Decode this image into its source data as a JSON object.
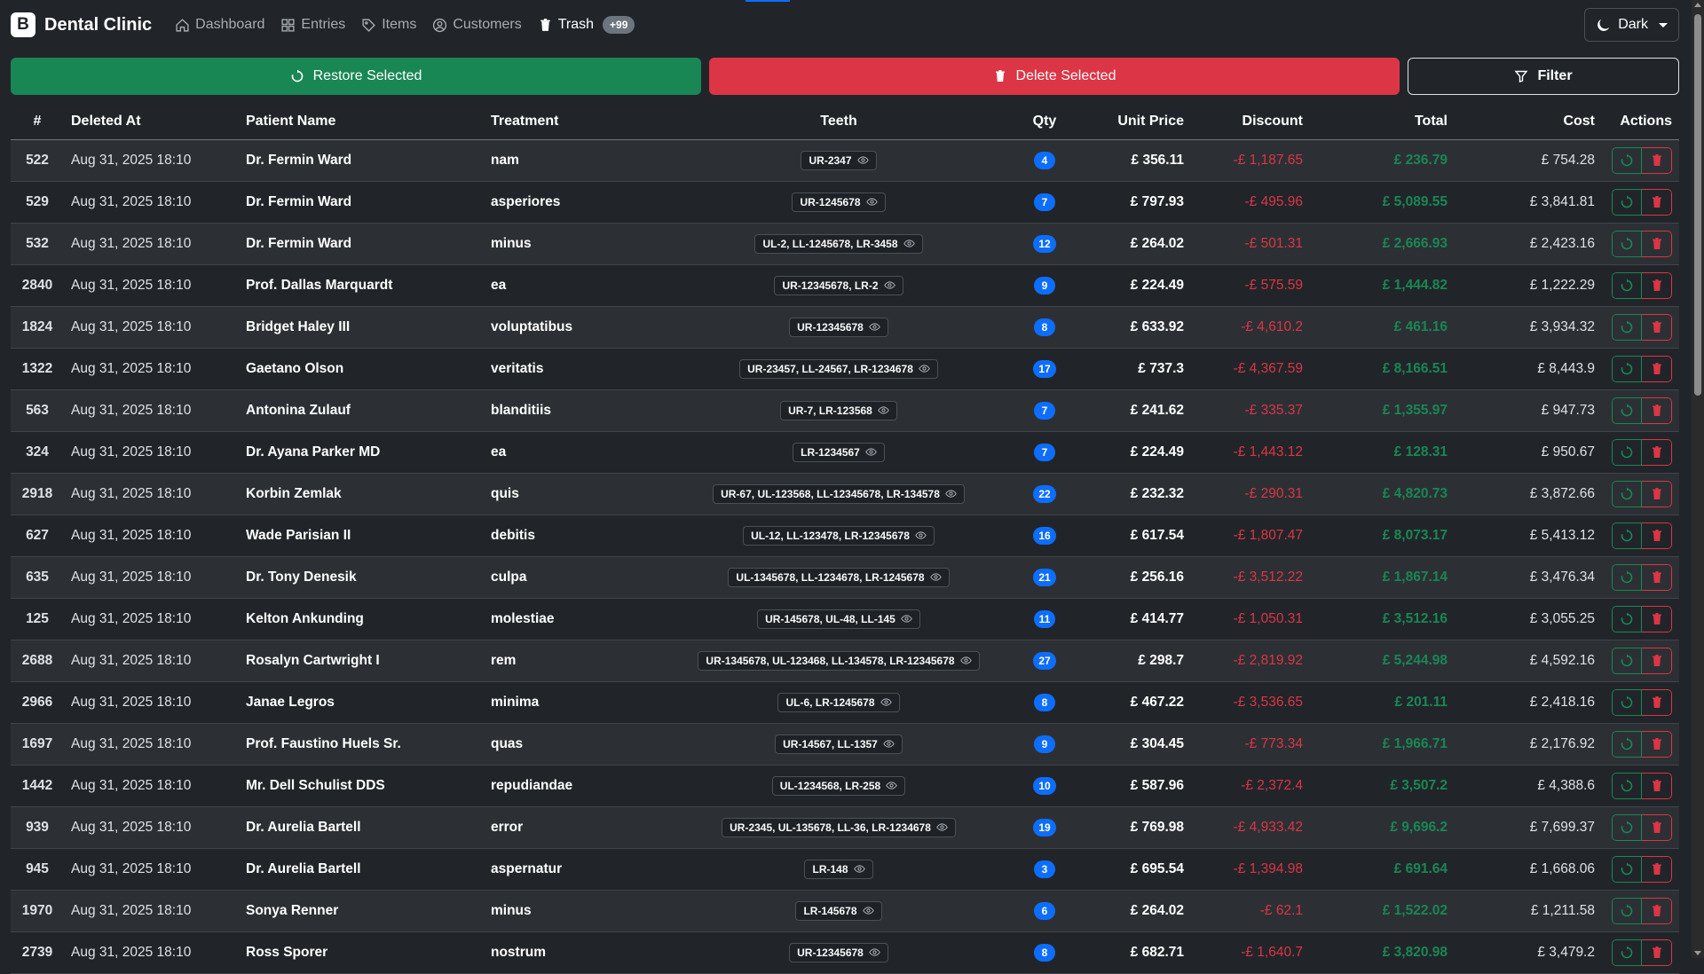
{
  "navbar": {
    "brand_logo": "B",
    "brand_name": "Dental Clinic",
    "links": [
      {
        "label": "Dashboard",
        "icon": "home-icon"
      },
      {
        "label": "Entries",
        "icon": "grid-icon"
      },
      {
        "label": "Items",
        "icon": "tag-icon"
      },
      {
        "label": "Customers",
        "icon": "user-circle-icon"
      },
      {
        "label": "Trash",
        "icon": "trash-icon"
      }
    ],
    "trash_badge": "+99",
    "theme_label": "Dark"
  },
  "actions": {
    "restore_label": "Restore Selected",
    "delete_label": "Delete Selected",
    "filter_label": "Filter"
  },
  "colors": {
    "background": "#212529",
    "success": "#198754",
    "danger": "#dc3545",
    "primary": "#0d6efd"
  },
  "table": {
    "headers": {
      "id": "#",
      "deleted_at": "Deleted At",
      "patient": "Patient Name",
      "treatment": "Treatment",
      "teeth": "Teeth",
      "qty": "Qty",
      "unit_price": "Unit Price",
      "discount": "Discount",
      "total": "Total",
      "cost": "Cost",
      "actions": "Actions"
    },
    "rows": [
      {
        "id": "522",
        "deleted_at": "Aug 31, 2025 18:10",
        "patient": "Dr. Fermin Ward",
        "treatment": "nam",
        "teeth": "UR-2347",
        "qty": "4",
        "unit_price": "£ 356.11",
        "discount": "-£ 1,187.65",
        "total": "£ 236.79",
        "cost": "£ 754.28"
      },
      {
        "id": "529",
        "deleted_at": "Aug 31, 2025 18:10",
        "patient": "Dr. Fermin Ward",
        "treatment": "asperiores",
        "teeth": "UR-1245678",
        "qty": "7",
        "unit_price": "£ 797.93",
        "discount": "-£ 495.96",
        "total": "£ 5,089.55",
        "cost": "£ 3,841.81"
      },
      {
        "id": "532",
        "deleted_at": "Aug 31, 2025 18:10",
        "patient": "Dr. Fermin Ward",
        "treatment": "minus",
        "teeth": "UL-2, LL-1245678, LR-3458",
        "qty": "12",
        "unit_price": "£ 264.02",
        "discount": "-£ 501.31",
        "total": "£ 2,666.93",
        "cost": "£ 2,423.16"
      },
      {
        "id": "2840",
        "deleted_at": "Aug 31, 2025 18:10",
        "patient": "Prof. Dallas Marquardt",
        "treatment": "ea",
        "teeth": "UR-12345678, LR-2",
        "qty": "9",
        "unit_price": "£ 224.49",
        "discount": "-£ 575.59",
        "total": "£ 1,444.82",
        "cost": "£ 1,222.29"
      },
      {
        "id": "1824",
        "deleted_at": "Aug 31, 2025 18:10",
        "patient": "Bridget Haley III",
        "treatment": "voluptatibus",
        "teeth": "UR-12345678",
        "qty": "8",
        "unit_price": "£ 633.92",
        "discount": "-£ 4,610.2",
        "total": "£ 461.16",
        "cost": "£ 3,934.32"
      },
      {
        "id": "1322",
        "deleted_at": "Aug 31, 2025 18:10",
        "patient": "Gaetano Olson",
        "treatment": "veritatis",
        "teeth": "UR-23457, LL-24567, LR-1234678",
        "qty": "17",
        "unit_price": "£ 737.3",
        "discount": "-£ 4,367.59",
        "total": "£ 8,166.51",
        "cost": "£ 8,443.9"
      },
      {
        "id": "563",
        "deleted_at": "Aug 31, 2025 18:10",
        "patient": "Antonina Zulauf",
        "treatment": "blanditiis",
        "teeth": "UR-7, LR-123568",
        "qty": "7",
        "unit_price": "£ 241.62",
        "discount": "-£ 335.37",
        "total": "£ 1,355.97",
        "cost": "£ 947.73"
      },
      {
        "id": "324",
        "deleted_at": "Aug 31, 2025 18:10",
        "patient": "Dr. Ayana Parker MD",
        "treatment": "ea",
        "teeth": "LR-1234567",
        "qty": "7",
        "unit_price": "£ 224.49",
        "discount": "-£ 1,443.12",
        "total": "£ 128.31",
        "cost": "£ 950.67"
      },
      {
        "id": "2918",
        "deleted_at": "Aug 31, 2025 18:10",
        "patient": "Korbin Zemlak",
        "treatment": "quis",
        "teeth": "UR-67, UL-123568, LL-12345678, LR-134578",
        "qty": "22",
        "unit_price": "£ 232.32",
        "discount": "-£ 290.31",
        "total": "£ 4,820.73",
        "cost": "£ 3,872.66"
      },
      {
        "id": "627",
        "deleted_at": "Aug 31, 2025 18:10",
        "patient": "Wade Parisian II",
        "treatment": "debitis",
        "teeth": "UL-12, LL-123478, LR-12345678",
        "qty": "16",
        "unit_price": "£ 617.54",
        "discount": "-£ 1,807.47",
        "total": "£ 8,073.17",
        "cost": "£ 5,413.12"
      },
      {
        "id": "635",
        "deleted_at": "Aug 31, 2025 18:10",
        "patient": "Dr. Tony Denesik",
        "treatment": "culpa",
        "teeth": "UL-1345678, LL-1234678, LR-1245678",
        "qty": "21",
        "unit_price": "£ 256.16",
        "discount": "-£ 3,512.22",
        "total": "£ 1,867.14",
        "cost": "£ 3,476.34"
      },
      {
        "id": "125",
        "deleted_at": "Aug 31, 2025 18:10",
        "patient": "Kelton Ankunding",
        "treatment": "molestiae",
        "teeth": "UR-145678, UL-48, LL-145",
        "qty": "11",
        "unit_price": "£ 414.77",
        "discount": "-£ 1,050.31",
        "total": "£ 3,512.16",
        "cost": "£ 3,055.25"
      },
      {
        "id": "2688",
        "deleted_at": "Aug 31, 2025 18:10",
        "patient": "Rosalyn Cartwright I",
        "treatment": "rem",
        "teeth": "UR-1345678, UL-123468, LL-134578, LR-12345678",
        "qty": "27",
        "unit_price": "£ 298.7",
        "discount": "-£ 2,819.92",
        "total": "£ 5,244.98",
        "cost": "£ 4,592.16"
      },
      {
        "id": "2966",
        "deleted_at": "Aug 31, 2025 18:10",
        "patient": "Janae Legros",
        "treatment": "minima",
        "teeth": "UL-6, LR-1245678",
        "qty": "8",
        "unit_price": "£ 467.22",
        "discount": "-£ 3,536.65",
        "total": "£ 201.11",
        "cost": "£ 2,418.16"
      },
      {
        "id": "1697",
        "deleted_at": "Aug 31, 2025 18:10",
        "patient": "Prof. Faustino Huels Sr.",
        "treatment": "quas",
        "teeth": "UR-14567, LL-1357",
        "qty": "9",
        "unit_price": "£ 304.45",
        "discount": "-£ 773.34",
        "total": "£ 1,966.71",
        "cost": "£ 2,176.92"
      },
      {
        "id": "1442",
        "deleted_at": "Aug 31, 2025 18:10",
        "patient": "Mr. Dell Schulist DDS",
        "treatment": "repudiandae",
        "teeth": "UL-1234568, LR-258",
        "qty": "10",
        "unit_price": "£ 587.96",
        "discount": "-£ 2,372.4",
        "total": "£ 3,507.2",
        "cost": "£ 4,388.6"
      },
      {
        "id": "939",
        "deleted_at": "Aug 31, 2025 18:10",
        "patient": "Dr. Aurelia Bartell",
        "treatment": "error",
        "teeth": "UR-2345, UL-135678, LL-36, LR-1234678",
        "qty": "19",
        "unit_price": "£ 769.98",
        "discount": "-£ 4,933.42",
        "total": "£ 9,696.2",
        "cost": "£ 7,699.37"
      },
      {
        "id": "945",
        "deleted_at": "Aug 31, 2025 18:10",
        "patient": "Dr. Aurelia Bartell",
        "treatment": "aspernatur",
        "teeth": "LR-148",
        "qty": "3",
        "unit_price": "£ 695.54",
        "discount": "-£ 1,394.98",
        "total": "£ 691.64",
        "cost": "£ 1,668.06"
      },
      {
        "id": "1970",
        "deleted_at": "Aug 31, 2025 18:10",
        "patient": "Sonya Renner",
        "treatment": "minus",
        "teeth": "LR-145678",
        "qty": "6",
        "unit_price": "£ 264.02",
        "discount": "-£ 62.1",
        "total": "£ 1,522.02",
        "cost": "£ 1,211.58"
      },
      {
        "id": "2739",
        "deleted_at": "Aug 31, 2025 18:10",
        "patient": "Ross Sporer",
        "treatment": "nostrum",
        "teeth": "UR-12345678",
        "qty": "8",
        "unit_price": "£ 682.71",
        "discount": "-£ 1,640.7",
        "total": "£ 3,820.98",
        "cost": "£ 3,479.2"
      }
    ]
  }
}
